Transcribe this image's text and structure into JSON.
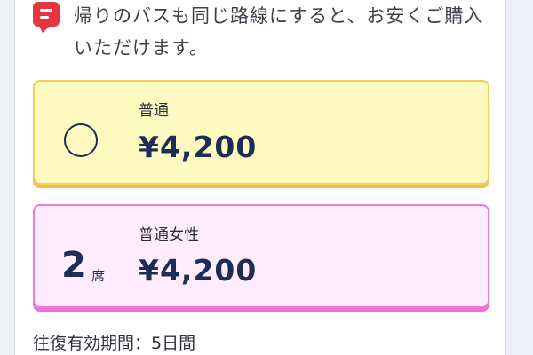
{
  "notice": {
    "icon": "message-icon",
    "text": "帰りのバスも同じ路線にすると、お安くご購入いただけます。"
  },
  "fares": [
    {
      "label": "普通",
      "price": "¥4,200",
      "availability": "○",
      "accent": "#f3cd57",
      "background": "#fffbc0"
    },
    {
      "label": "普通女性",
      "price": "¥4,200",
      "seats": "2",
      "seats_unit": "席",
      "accent": "#f07bd7",
      "background": "#ffecff"
    }
  ],
  "validity_text": "往復有効期間：5日間"
}
